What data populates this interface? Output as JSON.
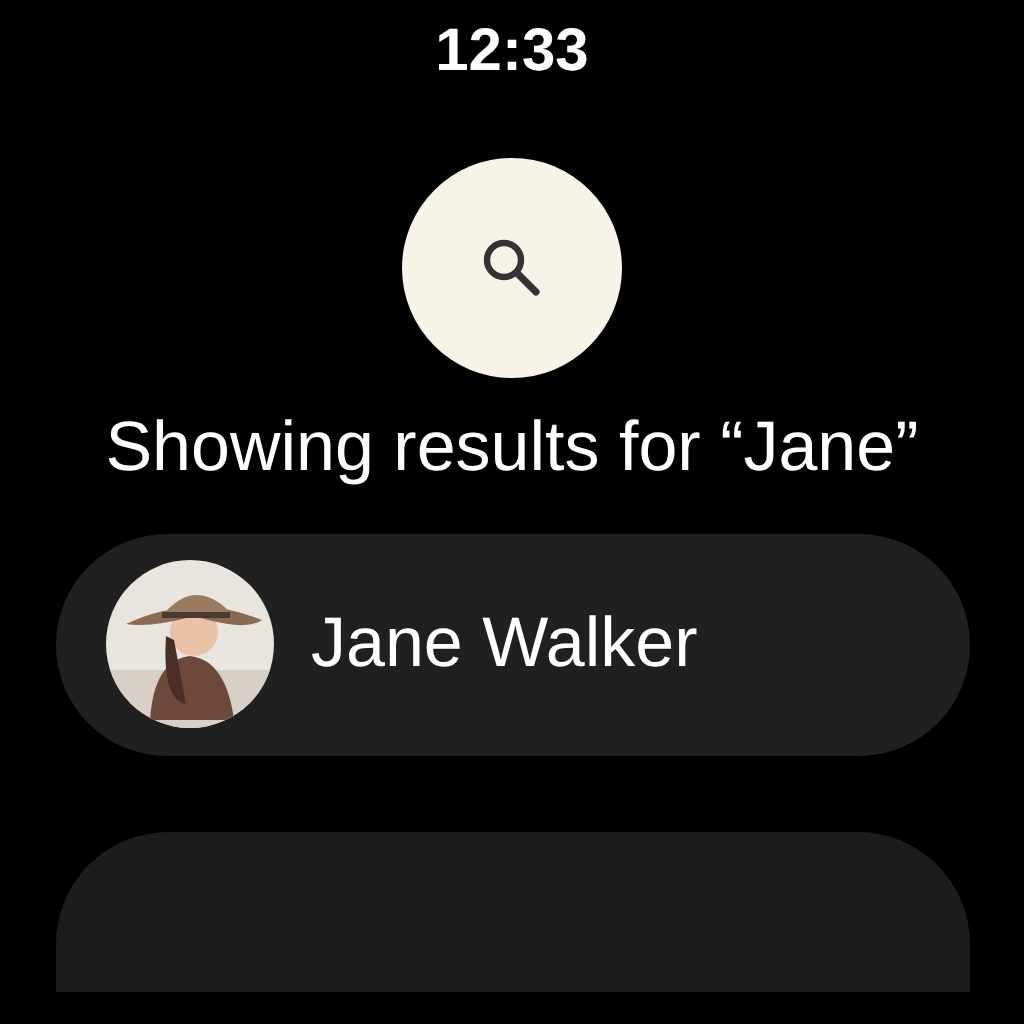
{
  "status_bar": {
    "time": "12:33"
  },
  "search_button": {
    "kind": "search"
  },
  "heading": "Showing results for “Jane”",
  "results": [
    {
      "name": "Jane Walker",
      "kind": "picture"
    }
  ]
}
